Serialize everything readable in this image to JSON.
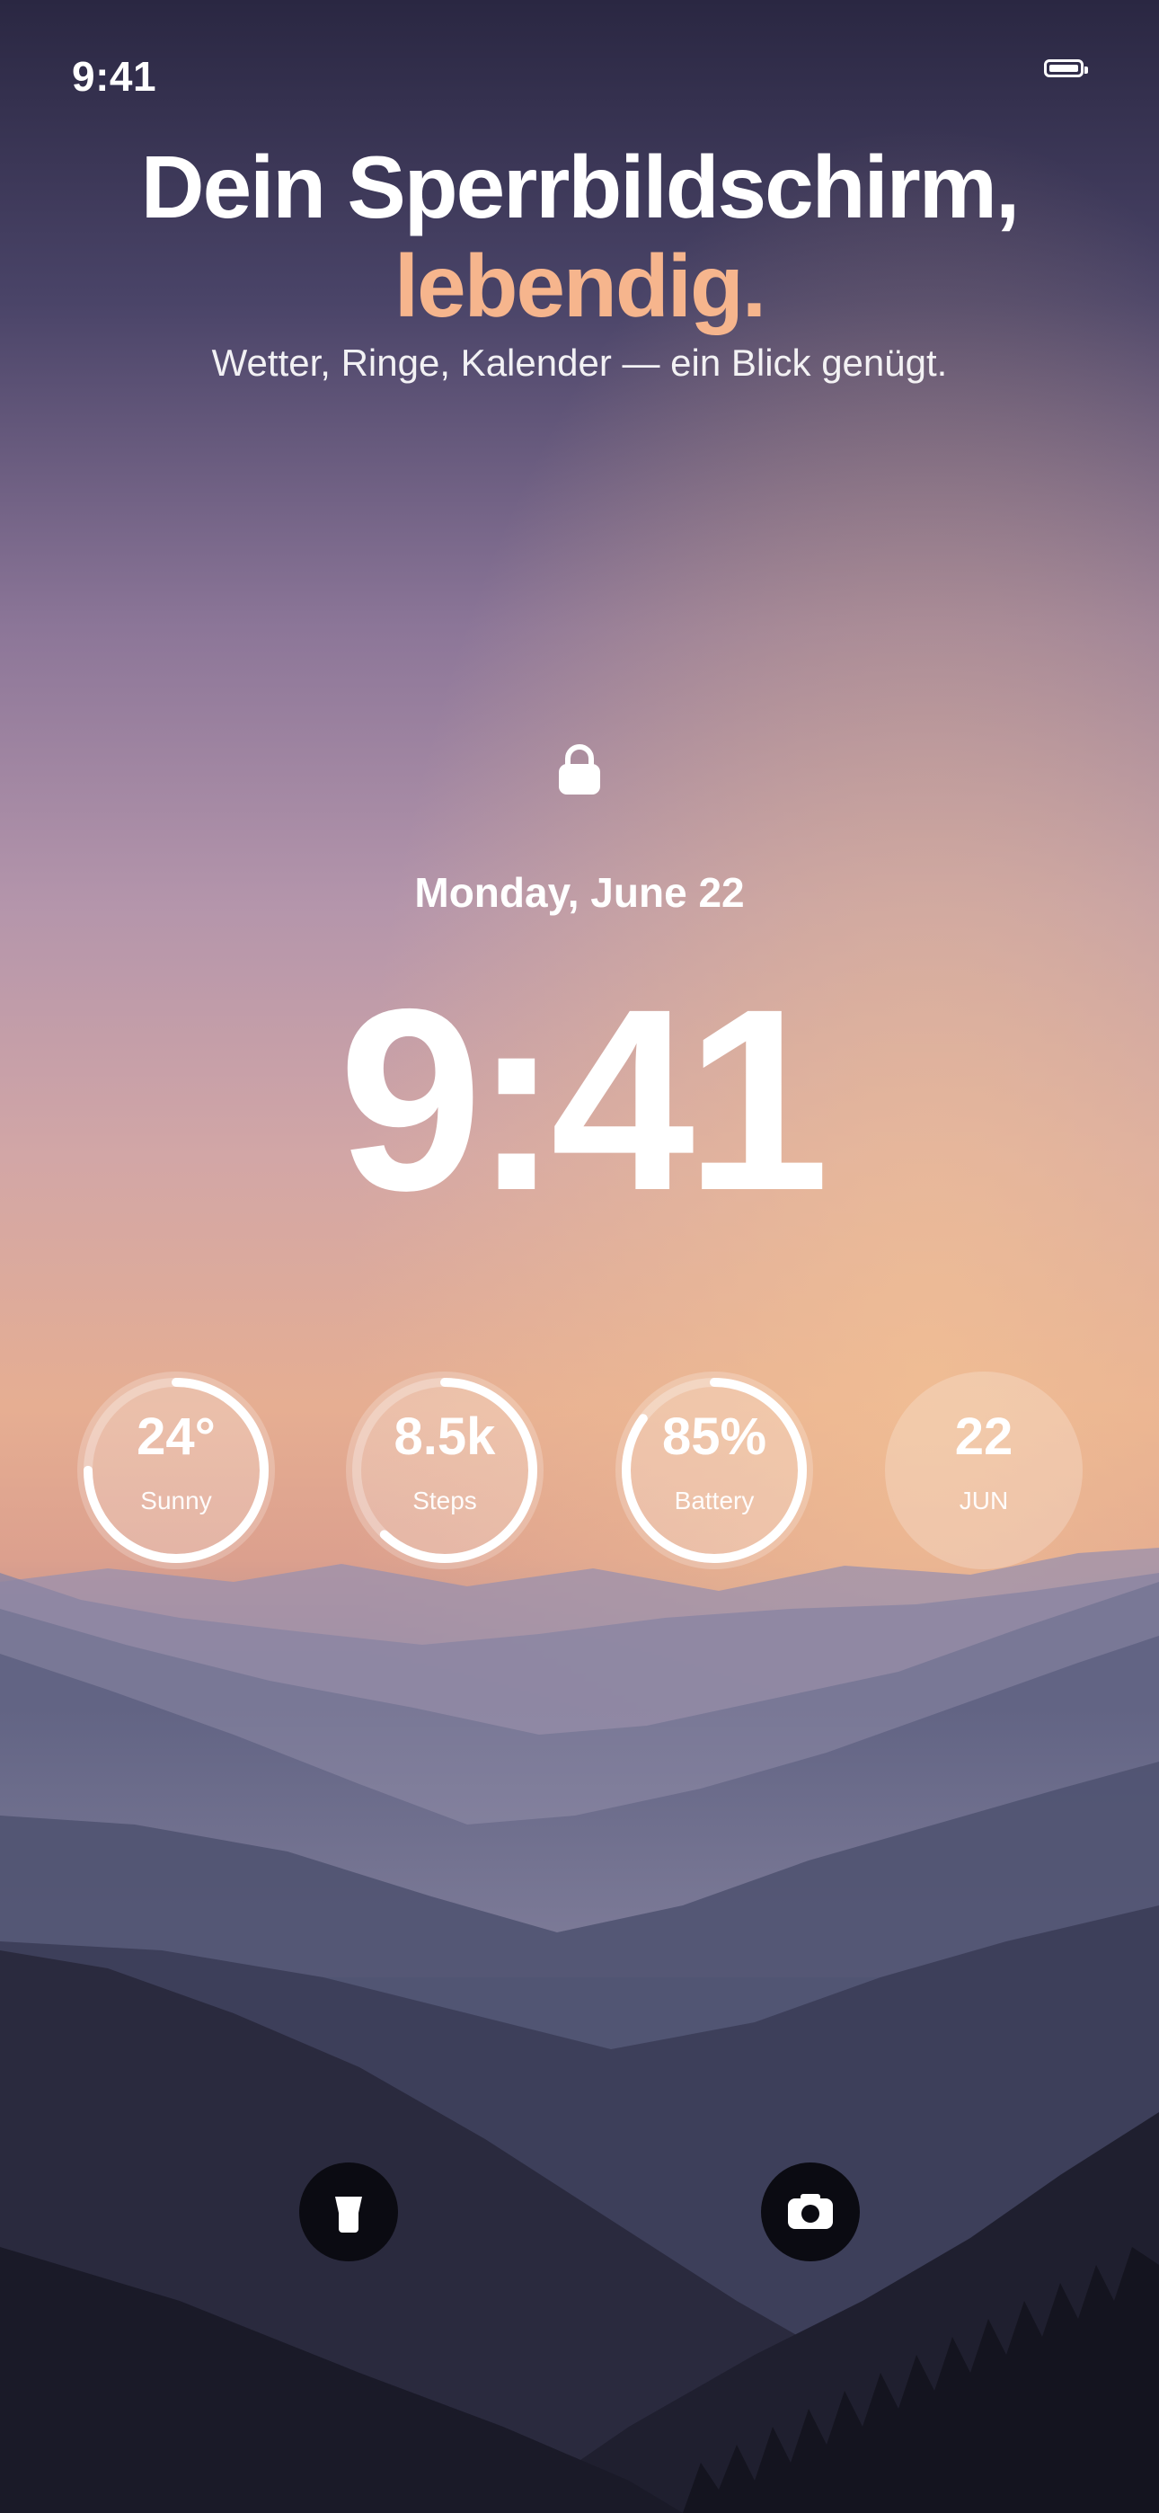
{
  "status_bar": {
    "time": "9:41"
  },
  "header": {
    "title_line1": "Dein Sperrbildschirm,",
    "title_line2": "lebendig.",
    "subtitle": "Wetter, Ringe, Kalender — ein Blick genügt."
  },
  "lock_screen": {
    "date": "Monday, June 22",
    "time": "9:41"
  },
  "widgets": [
    {
      "value": "24°",
      "label": "Sunny",
      "progress": 0.75,
      "icon": "weather-ring"
    },
    {
      "value": "8.5k",
      "label": "Steps",
      "progress": 0.62,
      "icon": "steps-ring"
    },
    {
      "value": "85%",
      "label": "Battery",
      "progress": 0.85,
      "icon": "battery-ring"
    },
    {
      "value": "22",
      "label": "JUN",
      "progress": null,
      "icon": "calendar"
    }
  ],
  "actions": {
    "left": {
      "icon": "flashlight-icon"
    },
    "right": {
      "icon": "camera-icon"
    }
  },
  "colors": {
    "accent": "#f6b58d",
    "text": "#ffffff",
    "button_bg": "#0b0b12"
  }
}
